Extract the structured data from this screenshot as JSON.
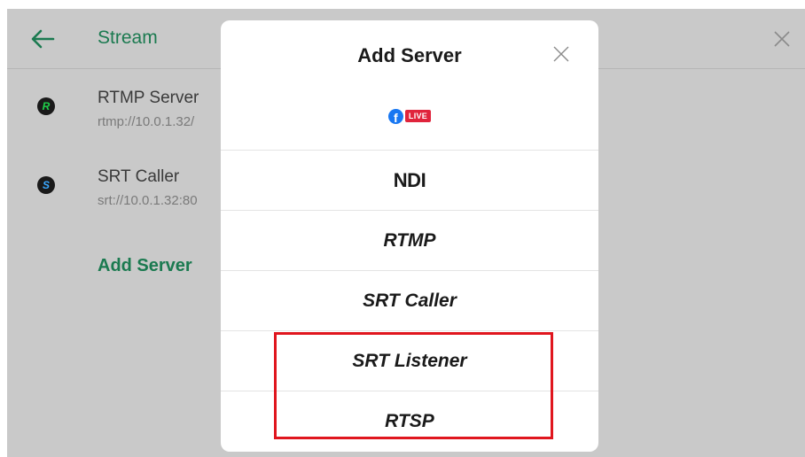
{
  "header": {
    "title": "Stream"
  },
  "servers": [
    {
      "logo_letter": "R",
      "logo_color": "#1fd04a",
      "name": "RTMP Server",
      "url": "rtmp://10.0.1.32/"
    },
    {
      "logo_letter": "S",
      "logo_color": "#3aa8ff",
      "name": "SRT Caller",
      "url": "srt://10.0.1.32:80"
    }
  ],
  "add_server_link": "Add Server",
  "modal": {
    "title": "Add Server",
    "options": {
      "facebook": {
        "live_badge": "LIVE",
        "fb_letter": "f"
      },
      "ndi": "NDI",
      "rtmp": "RTMP",
      "srt_caller": "SRT Caller",
      "srt_listener": "SRT Listener",
      "rtsp": "RTSP"
    }
  },
  "colors": {
    "accent": "#1b7a50",
    "highlight": "#e0161e",
    "facebook_blue": "#1877f2",
    "live_red": "#e0243c"
  }
}
